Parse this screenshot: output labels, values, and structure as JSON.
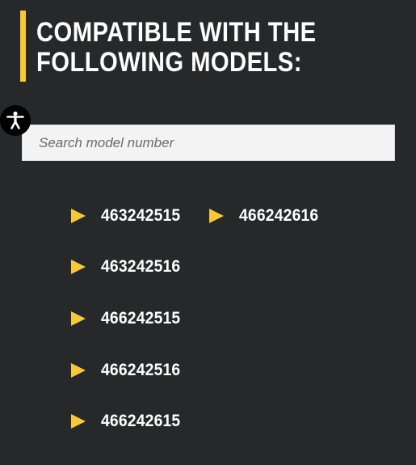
{
  "heading": {
    "line1": "COMPATIBLE WITH THE",
    "line2": "FOLLOWING MODELS:"
  },
  "accessibility_button": {
    "icon": "accessibility-person-icon"
  },
  "search": {
    "placeholder": "Search model number",
    "value": ""
  },
  "models": [
    {
      "number": "463242515",
      "icon": "triangle-right-icon"
    },
    {
      "number": "466242616",
      "icon": "triangle-right-icon"
    },
    {
      "number": "463242516",
      "icon": "triangle-right-icon"
    },
    {
      "number": "466242515",
      "icon": "triangle-right-icon"
    },
    {
      "number": "466242516",
      "icon": "triangle-right-icon"
    },
    {
      "number": "466242615",
      "icon": "triangle-right-icon"
    }
  ],
  "colors": {
    "background": "#272829",
    "accent": "#f5c93b",
    "text": "#ffffff",
    "search_bg": "#f3f3f3"
  }
}
